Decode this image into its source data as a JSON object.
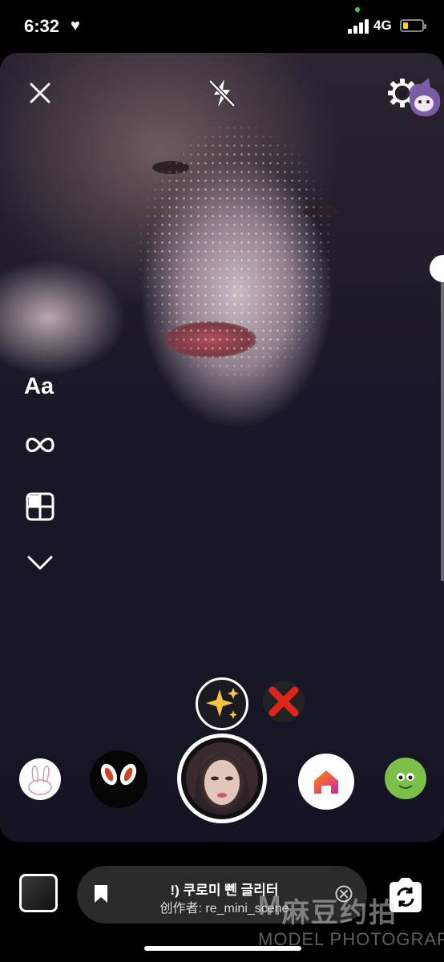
{
  "status_bar": {
    "time": "6:32",
    "heart": "♥",
    "network": "4G",
    "battery_level": 0.2
  },
  "top_controls": {
    "close_icon": "close-icon",
    "flash_icon": "flash-off-icon",
    "settings_icon": "gear-icon"
  },
  "side_tools": {
    "text_label": "Aa",
    "boomerang_icon": "infinity-icon",
    "layout_icon": "layout-icon",
    "more_icon": "chevron-down-icon"
  },
  "effects": {
    "selected_effect_icon": "sparkles-icon",
    "remove_effect_icon": "red-x-icon"
  },
  "effect_info": {
    "title": "!) 쿠로미 뻰 글리터",
    "author": "创作者: re_mini_scene"
  },
  "watermark": {
    "brand_cn": "麻豆约拍",
    "brand_en": "MODEL PHOTOGRAPH"
  },
  "colors": {
    "accent_yellow": "#ffd60a",
    "signal_green": "#32d74b",
    "effect_red": "#e0241b"
  }
}
